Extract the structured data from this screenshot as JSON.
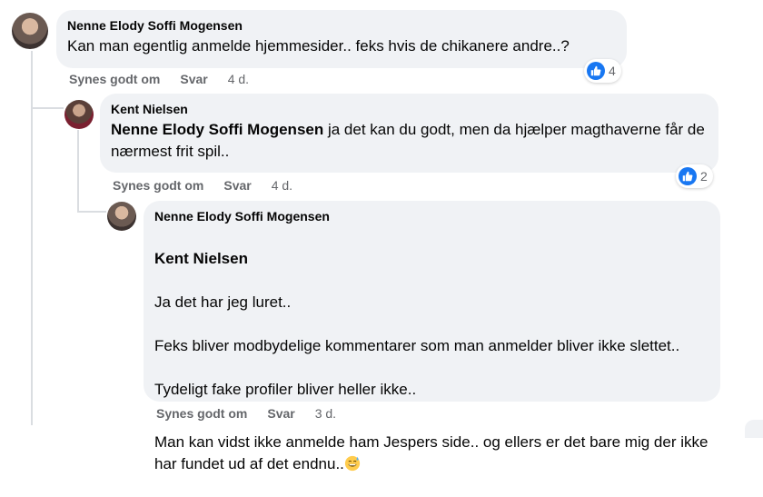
{
  "comments": [
    {
      "author": "Nenne Elody Soffi Mogensen",
      "text": "Kan man egentlig anmelde hjemmesider.. feks hvis de chikanere andre..?",
      "like_label": "Synes godt om",
      "reply_label": "Svar",
      "time": "4 d.",
      "reaction_count": "4",
      "reaction_icon": "like-icon"
    },
    {
      "author": "Kent Nielsen",
      "mention": "Nenne Elody Soffi Mogensen",
      "text": " ja det kan du godt, men da hjælper magthaverne får de nærmest frit spil..",
      "like_label": "Synes godt om",
      "reply_label": "Svar",
      "time": "4 d.",
      "reaction_count": "2",
      "reaction_icon": "like-icon"
    },
    {
      "author": "Nenne Elody Soffi Mogensen",
      "mention": "Kent Nielsen",
      "lines": [
        "Ja det har jeg luret..",
        "Feks bliver modbydelige kommentarer som man anmelder bliver ikke slettet..",
        "Tydeligt fake profiler bliver heller ikke.."
      ],
      "paragraph2": "Man kan vidst ikke anmelde ham Jespers side.. og ellers er det bare mig der ikke har fundet ud af det endnu..",
      "emoji": "grinning-sweat-emoji",
      "like_label": "Synes godt om",
      "reply_label": "Svar",
      "time": "3 d."
    }
  ],
  "colors": {
    "bubble": "#f0f2f5",
    "meta": "#65676b",
    "like_blue": "#1877f2",
    "thread_line": "#dadde1"
  }
}
